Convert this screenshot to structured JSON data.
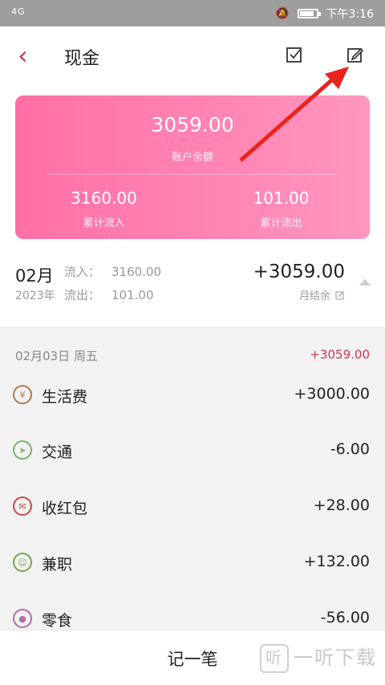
{
  "status_bar": {
    "network": "4G",
    "time": "下午3:16"
  },
  "header": {
    "title": "现金"
  },
  "summary": {
    "balance": "3059.00",
    "balance_label": "账户余额",
    "inflow": "3160.00",
    "inflow_label": "累计流入",
    "outflow": "101.00",
    "outflow_label": "累计流出"
  },
  "month": {
    "month": "02月",
    "year": "2023年",
    "in_label": "流入：",
    "in_value": "3160.00",
    "out_label": "流出：",
    "out_value": "101.00",
    "net": "+3059.00",
    "net_label": "月结余"
  },
  "day": {
    "date": "02月03日 周五",
    "total": "+3059.00"
  },
  "transactions": [
    {
      "name": "生活费",
      "amount": "+3000.00",
      "icon": "yen-icon",
      "color": "#b07a4a"
    },
    {
      "name": "交通",
      "amount": "-6.00",
      "icon": "paper-plane-icon",
      "color": "#7fb06b"
    },
    {
      "name": "收红包",
      "amount": "+28.00",
      "icon": "envelope-icon",
      "color": "#c84a4a"
    },
    {
      "name": "兼职",
      "amount": "+132.00",
      "icon": "person-icon",
      "color": "#7aa34f"
    },
    {
      "name": "零食",
      "amount": "-56.00",
      "icon": "lollipop-icon",
      "color": "#b56aa8"
    }
  ],
  "bottom": {
    "add_label": "记一笔",
    "watermark": "一听下载"
  },
  "colors": {
    "accent": "#d0364d",
    "card_start": "#ff6fa6",
    "card_end": "#ff97c0"
  }
}
